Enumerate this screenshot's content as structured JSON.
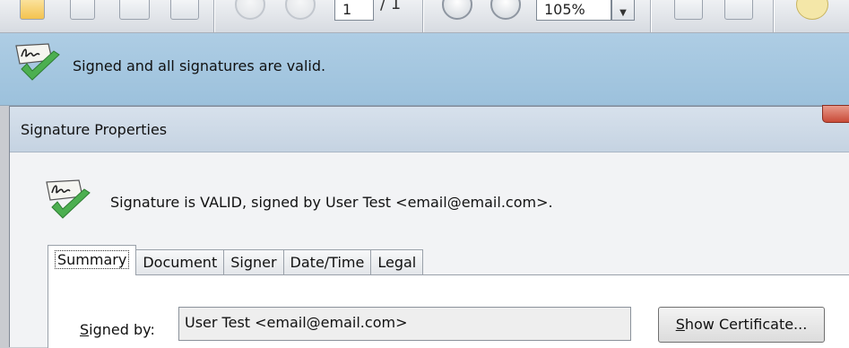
{
  "toolbar": {
    "page_current": "1",
    "page_total": "/ 1",
    "zoom": "105%"
  },
  "message_bar": {
    "text": "Signed and all signatures are valid."
  },
  "dialog": {
    "title": "Signature Properties",
    "status": "Signature is VALID, signed by User Test <email@email.com>.",
    "tabs": [
      "Summary",
      "Document",
      "Signer",
      "Date/Time",
      "Legal"
    ],
    "active_tab": "Summary",
    "summary": {
      "signed_by_label_prefix": "S",
      "signed_by_label_rest": "igned by:",
      "signed_by_value": "User Test <email@email.com>",
      "show_cert_prefix": "S",
      "show_cert_rest": "how Certificate..."
    }
  },
  "colors": {
    "message_bar": "#a8c9e1",
    "valid_check": "#4caf50"
  },
  "icons": [
    "save-icon",
    "print-icon",
    "email-icon",
    "prev-page-icon",
    "next-page-icon",
    "zoom-out-icon",
    "zoom-in-icon",
    "fit-width-icon",
    "fit-page-icon",
    "comment-icon",
    "signature-valid-icon",
    "close-icon"
  ]
}
